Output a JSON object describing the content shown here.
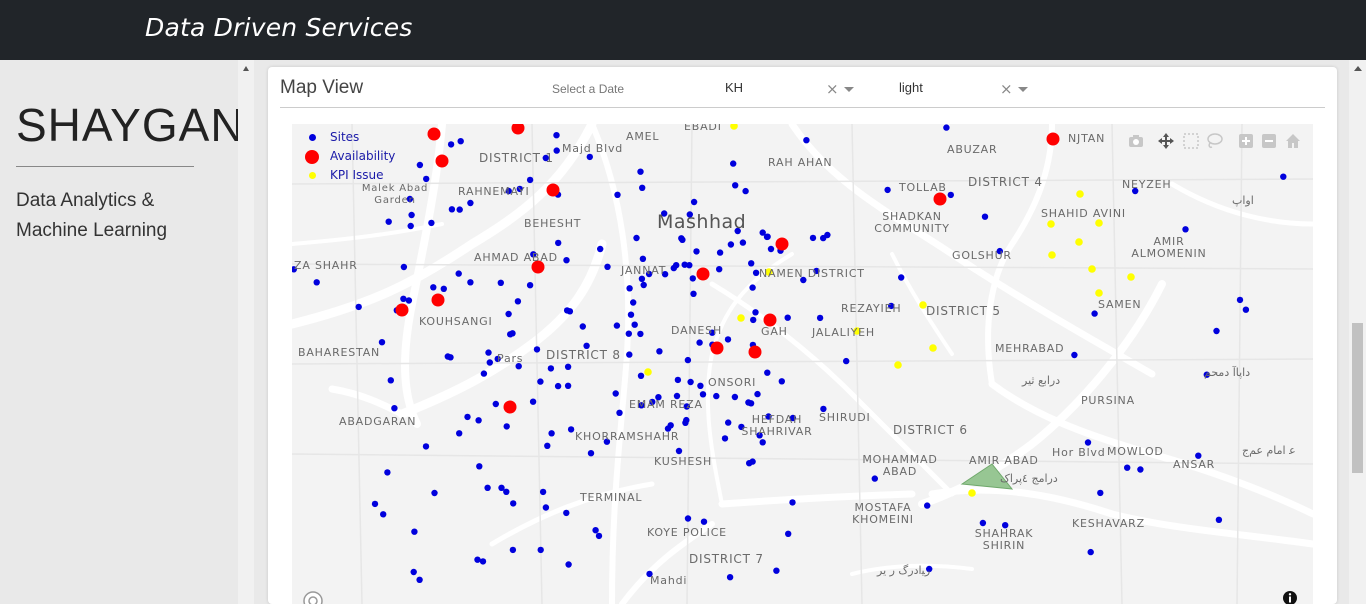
{
  "app": {
    "brand": "Data Driven Services"
  },
  "sidebar": {
    "logo": "SHAYGAN",
    "tagline": "Data Analytics & Machine Learning"
  },
  "card": {
    "title": "Map View",
    "date_placeholder": "Select a Date",
    "region_select": {
      "value": "KH",
      "clear": "×"
    },
    "style_select": {
      "value": "light",
      "clear": "×"
    }
  },
  "map": {
    "legend": [
      {
        "label": "Sites",
        "color": "#0000dd"
      },
      {
        "label": "Availability",
        "color": "#ff0000"
      },
      {
        "label": "KPI Issue",
        "color": "#ffff00"
      }
    ],
    "city_label": "Mashhad",
    "area_labels": [
      "DISTRICT 1",
      "DISTRICT 4",
      "DISTRICT 5",
      "DISTRICT 6",
      "DISTRICT 7",
      "DISTRICT 8",
      "AMEL",
      "EBADI",
      "RAH AHAN",
      "ABUZAR",
      "TOLLAB",
      "NEYZEH",
      "SHADKAN COMMUNITY",
      "SHAHID AVINI",
      "AMIR ALMOMENIN",
      "GOLSHUR",
      "SAMEN",
      "REZAYIEH",
      "JALALIYEH",
      "MEHRABAD",
      "PURSINA",
      "MOWLOD",
      "ANSAR",
      "KESHAVARZ",
      "AMIR ABAD",
      "SHAHRAK SHIRIN",
      "MOSTAFA KHOMEINI",
      "MOHAMMAD ABAD",
      "SHIRUDI",
      "HEFDAH SHAHRIVAR",
      "EMAM REZA",
      "KHORRAMSHAHR",
      "KUSHESH",
      "TERMINAL",
      "KOYE POLICE",
      "DANESH",
      "GAH",
      "NAMEN DISTRICT",
      "JANNAT",
      "BEHESHT",
      "AHMAD ABAD",
      "RAHNEMAYI",
      "Malek Abad Garden",
      "KOUHSANGI",
      "BAHARESTAN",
      "ABADGARAN",
      "ZA SHAHR",
      "NJTAN",
      "Pars",
      "Majd Blvd",
      "Hor Blvd",
      "Mahdi",
      "ONSORI"
    ],
    "persian_labels": [
      "اواپ",
      "داپاآ دمحم",
      "ع‍ امام عم‌ج",
      "درابع ثیر‌",
      "درامج ٤پراک",
      "ﺭﻴﺍﺩﺭگ ﺭ‍ یر"
    ],
    "icons": [
      "camera-icon",
      "pan-icon",
      "box-select-icon",
      "lasso-icon",
      "zoom-in-icon",
      "zoom-out-icon",
      "home-icon",
      "mapbox-logo-icon",
      "info-icon"
    ]
  }
}
